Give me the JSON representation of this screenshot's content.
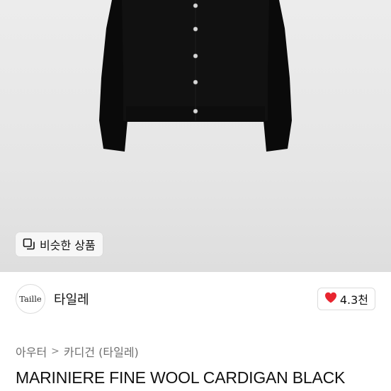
{
  "product_image": {
    "similar_button_label": "비슷한 상품",
    "similar_icon": "copy-icon"
  },
  "shop": {
    "avatar_text": "Taille",
    "name": "타일레",
    "like_icon": "heart-icon",
    "like_color": "#e8252f",
    "like_count": "4.3천"
  },
  "breadcrumb": {
    "items": [
      "아우터",
      "카디건 (타일레)"
    ],
    "separator": ">"
  },
  "product": {
    "title": "MARINIERE FINE WOOL CARDIGAN BLACK"
  }
}
